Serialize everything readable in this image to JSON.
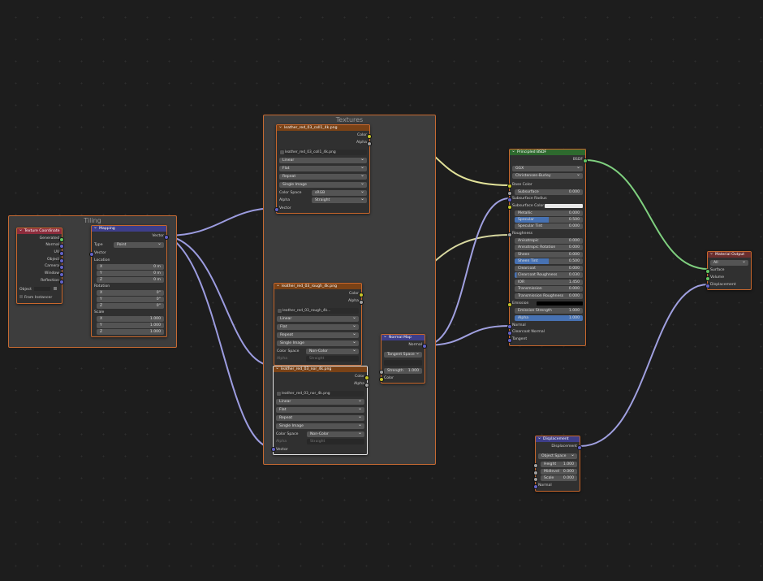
{
  "frames": {
    "tiling": "Tiling",
    "textures": "Textures"
  },
  "texcoord": {
    "title": "Texture Coordinate",
    "outs": [
      "Generated",
      "Normal",
      "UV",
      "Object",
      "Camera",
      "Window",
      "Reflection"
    ],
    "object_label": "Object",
    "from_instancer": "From Instancer"
  },
  "mapping": {
    "title": "Mapping",
    "out": "Vector",
    "type_label": "Type",
    "type_value": "Point",
    "in_vector": "Vector",
    "location": "Location",
    "rotation": "Rotation",
    "scale": "Scale",
    "loc": [
      [
        "X",
        "0 m"
      ],
      [
        "Y",
        "0 m"
      ],
      [
        "Z",
        "0 m"
      ]
    ],
    "rot": [
      [
        "X",
        "0°"
      ],
      [
        "Y",
        "0°"
      ],
      [
        "Z",
        "0°"
      ]
    ],
    "scl": [
      [
        "X",
        "1.000"
      ],
      [
        "Y",
        "1.000"
      ],
      [
        "Z",
        "1.000"
      ]
    ]
  },
  "tex1": {
    "title": "leather_red_03_coll1_4k.png",
    "color": "Color",
    "alpha": "Alpha",
    "file": "leather_red_03_coll1_4k.png",
    "interp": "Linear",
    "proj": "Flat",
    "ext": "Repeat",
    "src": "Single Image",
    "cs_label": "Color Space",
    "cs": "sRGB",
    "al_label": "Alpha",
    "al": "Straight",
    "vector": "Vector"
  },
  "tex2": {
    "title": "leather_red_03_rough_4k.png",
    "color": "Color",
    "alpha": "Alpha",
    "file": "leather_red_03_rough_4k...",
    "interp": "Linear",
    "proj": "Flat",
    "ext": "Repeat",
    "src": "Single Image",
    "cs_label": "Color Space",
    "cs": "Non-Color",
    "al_label": "Alpha",
    "al": "Straight"
  },
  "tex3": {
    "title": "leather_red_03_nor_4k.png",
    "color": "Color",
    "alpha": "Alpha",
    "file": "leather_red_03_nor_4k.png",
    "interp": "Linear",
    "proj": "Flat",
    "ext": "Repeat",
    "src": "Single Image",
    "cs_label": "Color Space",
    "cs": "Non-Color",
    "al_label": "Alpha",
    "al": "Straight",
    "vector": "Vector"
  },
  "normalmap": {
    "title": "Normal Map",
    "out": "Normal",
    "space": "Tangent Space",
    "strength_label": "Strength",
    "strength": "1.000",
    "color": "Color"
  },
  "bsdf": {
    "title": "Principled BSDF",
    "out": "BSDF",
    "dist": "GGX",
    "sss": "Christensen-Burley",
    "base_color": "Base Color",
    "subsurface": [
      "Subsurface",
      "0.000"
    ],
    "subsurface_radius": "Subsurface Radius",
    "subsurface_color": "Subsurface Color",
    "rows": [
      [
        "Metallic",
        "0.000",
        0
      ],
      [
        "Specular",
        "0.500",
        50
      ],
      [
        "Specular Tint",
        "0.000",
        0
      ]
    ],
    "roughness": "Roughness",
    "rows2": [
      [
        "Anisotropic",
        "0.000",
        0
      ],
      [
        "Anisotropic Rotation",
        "0.000",
        0
      ],
      [
        "Sheen",
        "0.000",
        0
      ],
      [
        "Sheen Tint",
        "0.500",
        50
      ],
      [
        "Clearcoat",
        "0.000",
        0
      ],
      [
        "Clearcoat Roughness",
        "0.030",
        3
      ],
      [
        "IOR",
        "1.450",
        0
      ],
      [
        "Transmission",
        "0.000",
        0
      ],
      [
        "Transmission Roughness",
        "0.000",
        0
      ]
    ],
    "emission": "Emission",
    "emission_strength": [
      "Emission Strength",
      "1.000"
    ],
    "alpha": [
      "Alpha",
      "1.000"
    ],
    "normal": "Normal",
    "clearcoat_normal": "Clearcoat Normal",
    "tangent": "Tangent"
  },
  "output": {
    "title": "Material Output",
    "target": "All",
    "surface": "Surface",
    "volume": "Volume",
    "displacement": "Displacement"
  },
  "disp": {
    "title": "Displacement",
    "out": "Displacement",
    "space": "Object Space",
    "height": [
      "Height",
      "1.000"
    ],
    "midlevel": [
      "Midlevel",
      "0.000"
    ],
    "scale": [
      "Scale",
      "0.000"
    ],
    "normal": "Normal"
  }
}
